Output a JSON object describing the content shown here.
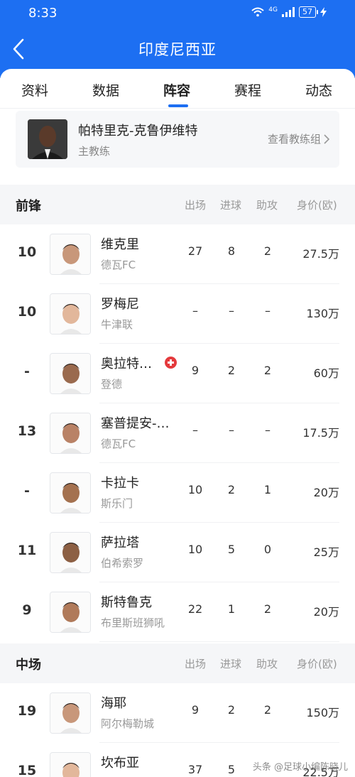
{
  "status": {
    "time": "8:33",
    "network": "4G",
    "battery": "57"
  },
  "header": {
    "title": "印度尼西亚"
  },
  "tabs": [
    "资料",
    "数据",
    "阵容",
    "赛程",
    "动态"
  ],
  "coach": {
    "name": "帕特里克-克鲁伊维特",
    "role": "主教练",
    "link": "查看教练组"
  },
  "columns": {
    "apps": "出场",
    "goals": "进球",
    "assists": "助攻",
    "value": "身价(欧)"
  },
  "sections": {
    "forwards": {
      "title": "前锋",
      "players": [
        {
          "num": "10",
          "name": "维克里",
          "club": "德瓦FC",
          "apps": "27",
          "goals": "8",
          "assists": "2",
          "value": "27.5万"
        },
        {
          "num": "10",
          "name": "罗梅尼",
          "club": "牛津联",
          "apps": "–",
          "goals": "–",
          "assists": "–",
          "value": "130万"
        },
        {
          "num": "-",
          "name": "奥拉特…",
          "club": "登德",
          "apps": "9",
          "goals": "2",
          "assists": "2",
          "value": "60万"
        },
        {
          "num": "13",
          "name": "塞普提安-…",
          "club": "德瓦FC",
          "apps": "–",
          "goals": "–",
          "assists": "–",
          "value": "17.5万"
        },
        {
          "num": "-",
          "name": "卡拉卡",
          "club": "斯乐门",
          "apps": "10",
          "goals": "2",
          "assists": "1",
          "value": "20万"
        },
        {
          "num": "11",
          "name": "萨拉塔",
          "club": "伯希索罗",
          "apps": "10",
          "goals": "5",
          "assists": "0",
          "value": "25万"
        },
        {
          "num": "9",
          "name": "斯特鲁克",
          "club": "布里斯班狮吼",
          "apps": "22",
          "goals": "1",
          "assists": "2",
          "value": "20万"
        }
      ]
    },
    "midfielders": {
      "title": "中场",
      "players": [
        {
          "num": "19",
          "name": "海耶",
          "club": "阿尔梅勒城",
          "apps": "9",
          "goals": "2",
          "assists": "2",
          "value": "150万"
        },
        {
          "num": "15",
          "name": "坎布亚",
          "club": "",
          "apps": "37",
          "goals": "5",
          "assists": "",
          "value": "22.5万"
        }
      ]
    }
  },
  "watermark": "头条 @足球小编陈晓儿"
}
